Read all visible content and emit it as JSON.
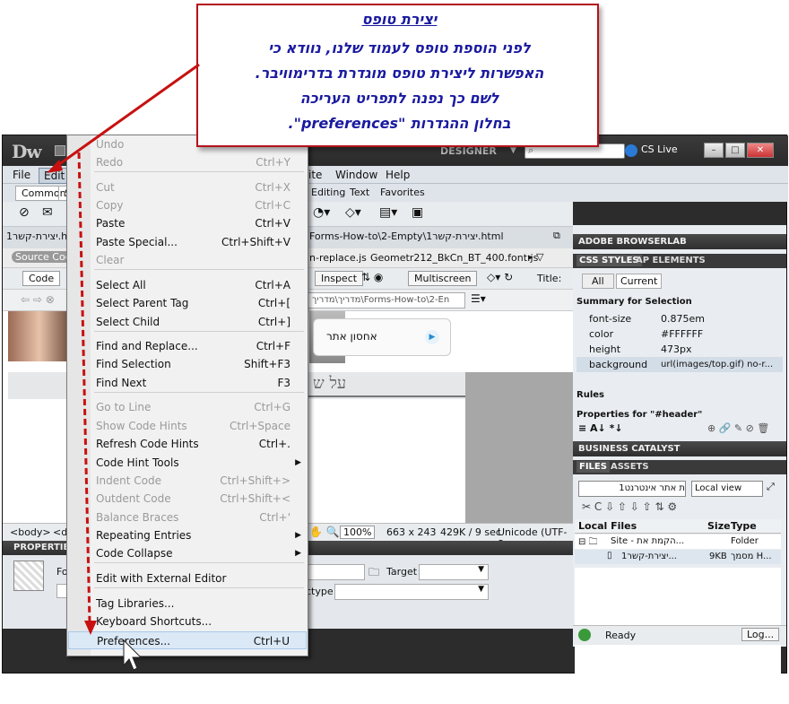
{
  "callout": {
    "title": "יצירת טופס",
    "lines": [
      "לפני הוספת טופס לעמוד שלנו, נוודא כי",
      "האפשרות ליצירת טופס מוגדרת בדרימוויבר.",
      "לשם כך נפנה לתפריט העריכה",
      "בחלון ההגדרות \"preferences\"."
    ]
  },
  "app": {
    "logo": "Dw",
    "workspace": "DESIGNER",
    "cslive": "CS Live"
  },
  "menubar": [
    "File",
    "Edit",
    "ite",
    "Window",
    "Help"
  ],
  "insert_tabs": [
    "Common",
    "S",
    "Editing",
    "Text",
    "Favorites"
  ],
  "doc": {
    "filename": "יצירת-קשר1.html",
    "path": "Forms-How-to\\2-Empty\\יצירת-קשר1.html",
    "related_files": [
      "n-replace.js",
      "Geometr212_BkCn_BT_400.font.js"
    ],
    "source_code": "Source Code",
    "view_code": "Code",
    "inspect": "Inspect",
    "multiscreen": "Multiscreen",
    "title_label": "Title:",
    "address": "מדריך\\מדריך\\Forms-How-to\\2-En",
    "search_text": "אחסון אתר",
    "heading_text": "על ש"
  },
  "status": {
    "tag": "<body>",
    "tag2": "<di",
    "zoom": "100%",
    "size": "663 x 243",
    "weight": "429K / 9 sec",
    "encoding": "Unicode (UTF-8"
  },
  "properties": {
    "header": "PROPERTIES",
    "fo": "Fo",
    "target_label": "Target",
    "ctype_label": "ctype"
  },
  "menu": {
    "items": [
      {
        "label": "Undo",
        "shortcut": "",
        "disabled": true
      },
      {
        "label": "Redo",
        "shortcut": "Ctrl+Y",
        "disabled": true
      },
      {
        "label": "Cut",
        "shortcut": "Ctrl+X",
        "disabled": true
      },
      {
        "label": "Copy",
        "shortcut": "Ctrl+C",
        "disabled": true
      },
      {
        "label": "Paste",
        "shortcut": "Ctrl+V"
      },
      {
        "label": "Paste Special...",
        "shortcut": "Ctrl+Shift+V"
      },
      {
        "label": "Clear",
        "shortcut": "",
        "disabled": true
      },
      {
        "label": "Select All",
        "shortcut": "Ctrl+A"
      },
      {
        "label": "Select Parent Tag",
        "shortcut": "Ctrl+["
      },
      {
        "label": "Select Child",
        "shortcut": "Ctrl+]"
      },
      {
        "label": "Find and Replace...",
        "shortcut": "Ctrl+F"
      },
      {
        "label": "Find Selection",
        "shortcut": "Shift+F3"
      },
      {
        "label": "Find Next",
        "shortcut": "F3"
      },
      {
        "label": "Go to Line",
        "shortcut": "Ctrl+G",
        "disabled": true
      },
      {
        "label": "Show Code Hints",
        "shortcut": "Ctrl+Space",
        "disabled": true
      },
      {
        "label": "Refresh Code Hints",
        "shortcut": "Ctrl+."
      },
      {
        "label": "Code Hint Tools",
        "shortcut": "",
        "submenu": true
      },
      {
        "label": "Indent Code",
        "shortcut": "Ctrl+Shift+>",
        "disabled": true
      },
      {
        "label": "Outdent Code",
        "shortcut": "Ctrl+Shift+<",
        "disabled": true
      },
      {
        "label": "Balance Braces",
        "shortcut": "Ctrl+'",
        "disabled": true
      },
      {
        "label": "Repeating Entries",
        "shortcut": "",
        "submenu": true
      },
      {
        "label": "Code Collapse",
        "shortcut": "",
        "submenu": true
      },
      {
        "label": "Edit with External Editor",
        "shortcut": ""
      },
      {
        "label": "Tag Libraries...",
        "shortcut": ""
      },
      {
        "label": "Keyboard Shortcuts...",
        "shortcut": ""
      },
      {
        "label": "Preferences...",
        "shortcut": "Ctrl+U",
        "highlighted": true
      }
    ]
  },
  "right": {
    "browserlab": "ADOBE BROWSERLAB",
    "css_styles": "CSS STYLES",
    "ap_elements": "AP ELEMENTS",
    "all": "All",
    "current": "Current",
    "summary": "Summary for Selection",
    "css_props": [
      {
        "name": "font-size",
        "value": "0.875em"
      },
      {
        "name": "color",
        "value": "#FFFFFF"
      },
      {
        "name": "height",
        "value": "473px"
      },
      {
        "name": "background",
        "value": "url(images/top.gif) no-r..."
      }
    ],
    "rules": "Rules",
    "properties_for": "Properties for \"#header\"",
    "business_catalyst": "BUSINESS CATALYST",
    "files": "FILES",
    "assets": "ASSETS",
    "site_select": "ת אתר אינטרנט1",
    "view_select": "Local view",
    "col_local": "Local Files",
    "col_size": "Size",
    "col_type": "Type",
    "file_rows": [
      {
        "name": "Site - הקמת את...",
        "size": "",
        "type": "Folder"
      },
      {
        "name": "יצירת-קשר1...",
        "size": "9KB",
        "type": "מסמך H..."
      }
    ],
    "ready": "Ready",
    "log": "Log..."
  },
  "colors": {
    "callout_border": "#b5121b",
    "callout_text": "#1a1aa0",
    "arrow": "#c81010"
  }
}
